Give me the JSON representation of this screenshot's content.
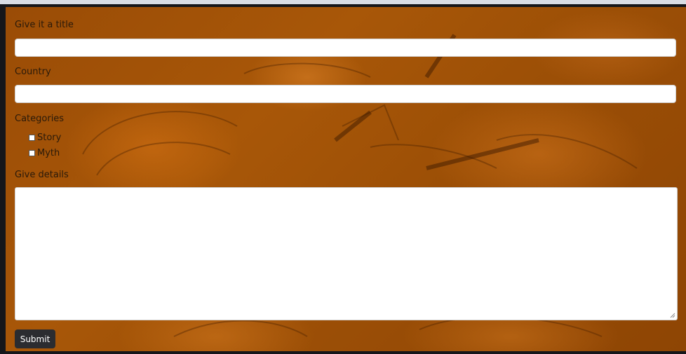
{
  "form": {
    "title_label": "Give it a title",
    "title_value": "",
    "country_label": "Country",
    "country_value": "",
    "categories_label": "Categories",
    "categories": [
      {
        "label": "Story",
        "checked": false
      },
      {
        "label": "Myth",
        "checked": false
      }
    ],
    "details_label": "Give details",
    "details_value": "",
    "submit_label": "Submit"
  },
  "colors": {
    "background": "#a85708",
    "button": "#2b2c30"
  }
}
